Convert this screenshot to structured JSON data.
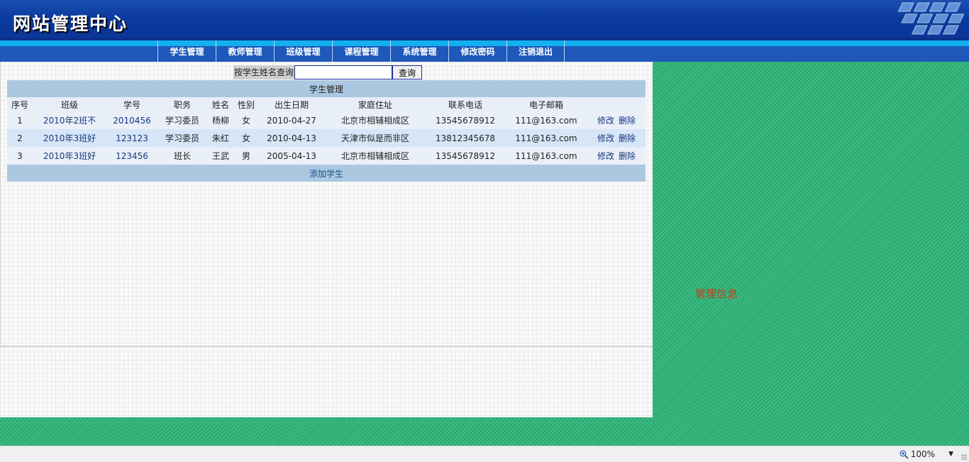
{
  "header": {
    "title": "网站管理中心"
  },
  "nav": {
    "items": [
      "学生管理",
      "教师管理",
      "班级管理",
      "课程管理",
      "系统管理",
      "修改密码",
      "注销退出"
    ]
  },
  "search": {
    "label": "按学生姓名查询",
    "value": "",
    "button": "查询"
  },
  "table": {
    "title": "学生管理",
    "columns": [
      "序号",
      "班级",
      "学号",
      "职务",
      "姓名",
      "性别",
      "出生日期",
      "家庭住址",
      "联系电话",
      "电子邮箱",
      ""
    ],
    "rows": [
      {
        "no": "1",
        "class": "2010年2班不",
        "id": "2010456",
        "role": "学习委员",
        "name": "杨柳",
        "gender": "女",
        "birth": "2010-04-27",
        "address": "北京市相辅相成区",
        "phone": "13545678912",
        "email": "111@163.com",
        "edit": "修改",
        "delete": "删除"
      },
      {
        "no": "2",
        "class": "2010年3班好",
        "id": "123123",
        "role": "学习委员",
        "name": "朱红",
        "gender": "女",
        "birth": "2010-04-13",
        "address": "天津市似是而非区",
        "phone": "13812345678",
        "email": "111@163.com",
        "edit": "修改",
        "delete": "删除"
      },
      {
        "no": "3",
        "class": "2010年3班好",
        "id": "123456",
        "role": "班长",
        "name": "王武",
        "gender": "男",
        "birth": "2005-04-13",
        "address": "北京市相辅相成区",
        "phone": "13545678912",
        "email": "111@163.com",
        "edit": "修改",
        "delete": "删除"
      }
    ],
    "add_label": "添加学生"
  },
  "right_panel": {
    "text": "管理信息"
  },
  "status": {
    "zoom": "100%"
  }
}
